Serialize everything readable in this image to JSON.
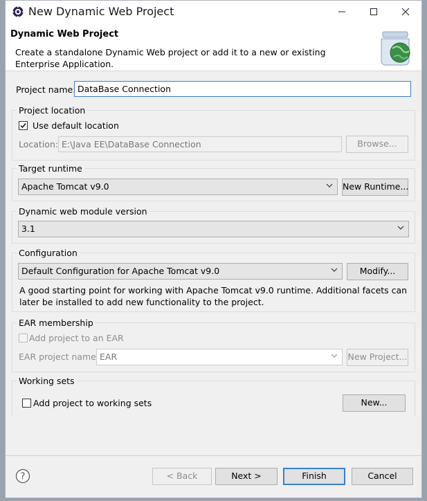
{
  "window": {
    "title": "New Dynamic Web Project",
    "controls": {
      "minimize": "—",
      "maximize": "☐",
      "close": "✕"
    }
  },
  "header": {
    "title": "Dynamic Web Project",
    "description": "Create a standalone Dynamic Web project or add it to a new or existing Enterprise Application."
  },
  "project_name": {
    "label": "Project name:",
    "value": "DataBase Connection"
  },
  "project_location": {
    "title": "Project location",
    "use_default_label": "Use default location",
    "use_default_checked": true,
    "location_label": "Location:",
    "location_value": "E:\\Java EE\\DataBase Connection",
    "browse_label": "Browse..."
  },
  "target_runtime": {
    "title": "Target runtime",
    "selected": "Apache Tomcat v9.0",
    "new_runtime_label": "New Runtime..."
  },
  "module_version": {
    "title": "Dynamic web module version",
    "selected": "3.1"
  },
  "configuration": {
    "title": "Configuration",
    "selected": "Default Configuration for Apache Tomcat v9.0",
    "modify_label": "Modify...",
    "description": "A good starting point for working with Apache Tomcat v9.0 runtime. Additional facets can later be installed to add new functionality to the project."
  },
  "ear_membership": {
    "title": "EAR membership",
    "add_label": "Add project to an EAR",
    "add_checked": false,
    "ear_name_label": "EAR project name:",
    "ear_name_value": "EAR",
    "new_project_label": "New Project..."
  },
  "working_sets": {
    "title": "Working sets",
    "add_label": "Add project to working sets",
    "add_checked": false,
    "new_label": "New..."
  },
  "footer": {
    "back_label": "< Back",
    "next_label": "Next >",
    "finish_label": "Finish",
    "cancel_label": "Cancel"
  },
  "icons": {
    "app": "eclipse-gear-icon",
    "banner": "web-project-globe-jar-icon",
    "help": "help-icon",
    "dropdown": "chevron-down-icon",
    "check": "checkmark-icon"
  }
}
